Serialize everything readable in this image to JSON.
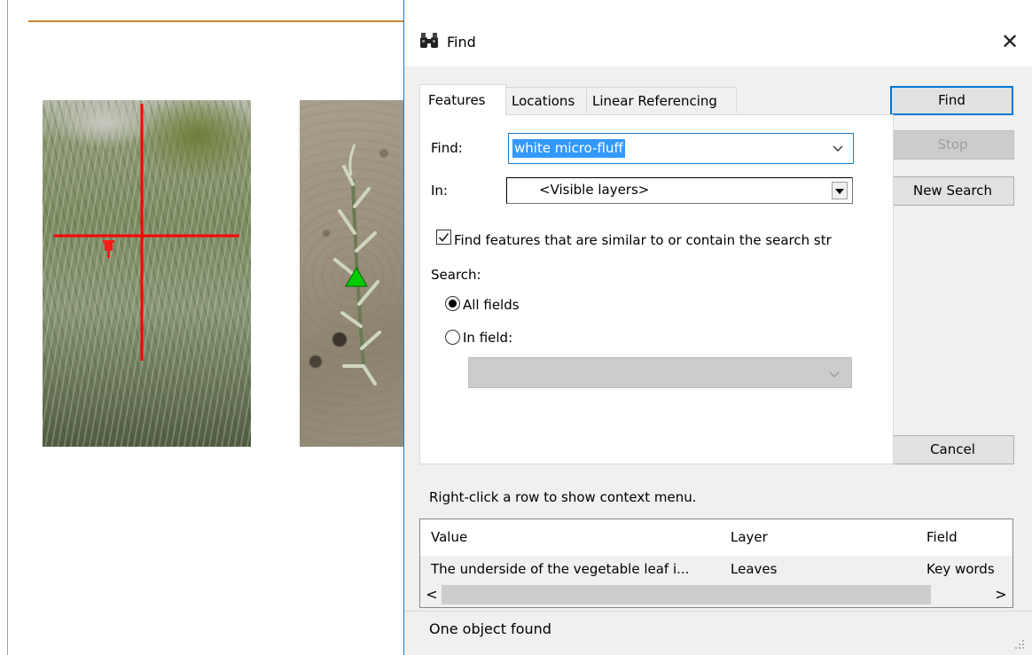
{
  "dialog": {
    "title": "Find",
    "close_glyph": "✕",
    "tabs": [
      {
        "label": "Features",
        "active": true
      },
      {
        "label": "Locations",
        "active": false
      },
      {
        "label": "Linear Referencing",
        "active": false
      }
    ],
    "find_label": "Find:",
    "find_value": "white micro-fluff",
    "in_label": "In:",
    "in_value": "<Visible layers>",
    "similar_checkbox": {
      "label": "Find features that are similar to or contain the search str",
      "checked": true
    },
    "search_label": "Search:",
    "radio_all_fields": {
      "label": "All fields",
      "selected": true
    },
    "radio_in_field": {
      "label": "In field:",
      "selected": false
    },
    "field_select_value": "",
    "buttons": {
      "find": "Find",
      "stop": "Stop",
      "new_search": "New Search",
      "cancel": "Cancel"
    },
    "hint": "Right-click a row to show context menu.",
    "results": {
      "columns": [
        "Value",
        "Layer",
        "Field"
      ],
      "rows": [
        {
          "value": "The underside of the vegetable leaf i...",
          "layer": "Leaves",
          "field": "Key words"
        }
      ],
      "scroll_left": "<",
      "scroll_right": ">"
    },
    "status": "One object found"
  },
  "icons": {
    "title_icon": "binoculars-icon",
    "combo_chevron": "chevron-down-icon",
    "resize": "resize-grip-icon"
  },
  "colors": {
    "accent": "#1c79c9",
    "selection": "#3399ff",
    "crosshair": "#ff0000",
    "marker_triangle": "#00cc00",
    "map_rule": "#c88a2e"
  }
}
